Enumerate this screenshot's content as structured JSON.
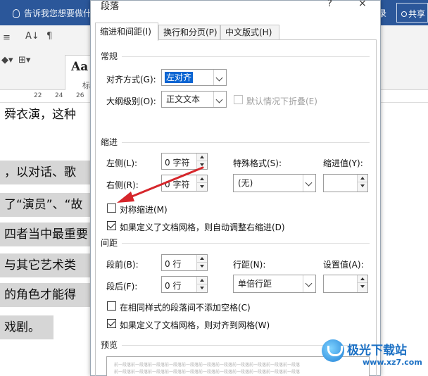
{
  "word": {
    "tell_me": "告诉我您想要做什么",
    "right_label": "录",
    "share_label": "共享",
    "styles_preview": "Aa",
    "styles_sub": "标",
    "ruler_ticks": [
      "22",
      "24",
      "26"
    ],
    "doc_lines": [
      "舜衣演，这种",
      "，以对话、歌",
      "了“演员”、“故",
      "四者当中最重要",
      "与其它艺术类",
      "的角色才能得",
      "戏剧。"
    ]
  },
  "dialog": {
    "title": "段落",
    "help": "?",
    "close": "×",
    "tabs": [
      "缩进和间距(I)",
      "换行和分页(P)",
      "中文版式(H)"
    ],
    "general": {
      "section": "常规",
      "alignment_label": "对齐方式(G):",
      "alignment_value": "左对齐",
      "outline_label": "大纲级别(O):",
      "outline_value": "正文文本",
      "collapse_label": "默认情况下折叠(E)"
    },
    "indent": {
      "section": "缩进",
      "left_label": "左侧(L):",
      "left_value": "0 字符",
      "right_label": "右侧(R):",
      "right_value": "0 字符",
      "special_label": "特殊格式(S):",
      "special_value": "(无)",
      "indent_value_label": "缩进值(Y):",
      "indent_value": "",
      "mirror_label": "对称缩进(M)",
      "auto_adjust_label": "如果定义了文档网格，则自动调整右缩进(D)"
    },
    "spacing": {
      "section": "间距",
      "before_label": "段前(B):",
      "before_value": "0 行",
      "after_label": "段后(F):",
      "after_value": "0 行",
      "line_label": "行距(N):",
      "line_value": "单倍行距",
      "setting_label": "设置值(A):",
      "setting_value": "",
      "no_space_label": "在相同样式的段落间不添加空格(C)",
      "snap_grid_label": "如果定义了文档网格，则对齐到网格(W)"
    },
    "preview": {
      "section": "预览",
      "sample_text": "前一段落前一段落前一段落前一段落前一段落前一段落前一段落前一段落前一段落前一段落前一段落"
    }
  },
  "watermark": {
    "name": "极光下载站",
    "url": "www.xz7.com"
  },
  "colors": {
    "title_bar": "#2b579a",
    "selection": "#0a64d2",
    "annotation_arrow": "#d6262b",
    "highlight": "#d6d6d6"
  }
}
